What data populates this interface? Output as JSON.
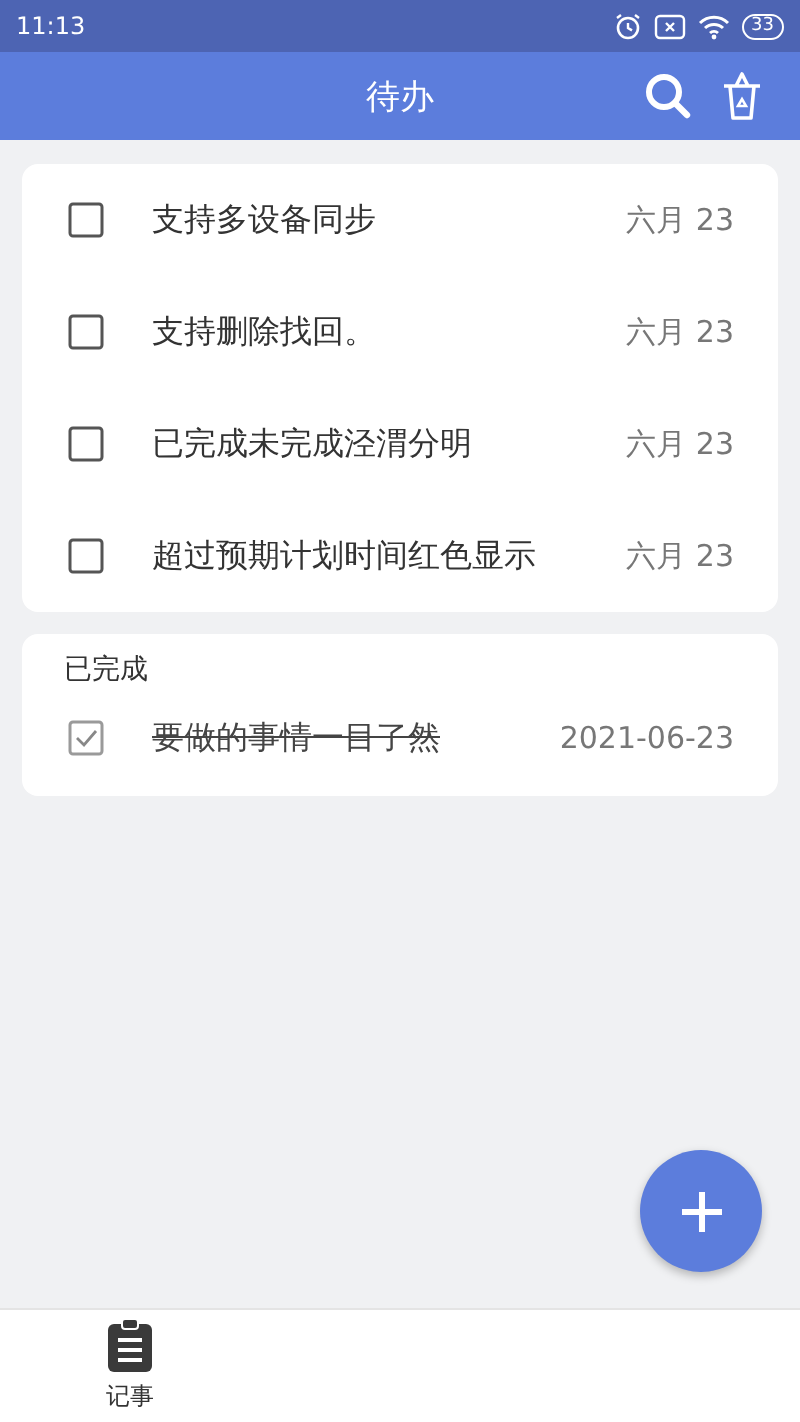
{
  "status_bar": {
    "time": "11:13",
    "battery": "33"
  },
  "header": {
    "title": "待办"
  },
  "todo_list": [
    {
      "text": "支持多设备同步",
      "date": "六月 23",
      "checked": false
    },
    {
      "text": "支持删除找回。",
      "date": "六月 23",
      "checked": false
    },
    {
      "text": "已完成未完成泾渭分明",
      "date": "六月 23",
      "checked": false
    },
    {
      "text": "超过预期计划时间红色显示",
      "date": "六月 23",
      "checked": false
    }
  ],
  "done_section": {
    "title": "已完成",
    "items": [
      {
        "text": "要做的事情一目了然",
        "date": "2021-06-23",
        "checked": true
      }
    ]
  },
  "bottom_nav": [
    {
      "label": "记事"
    }
  ]
}
